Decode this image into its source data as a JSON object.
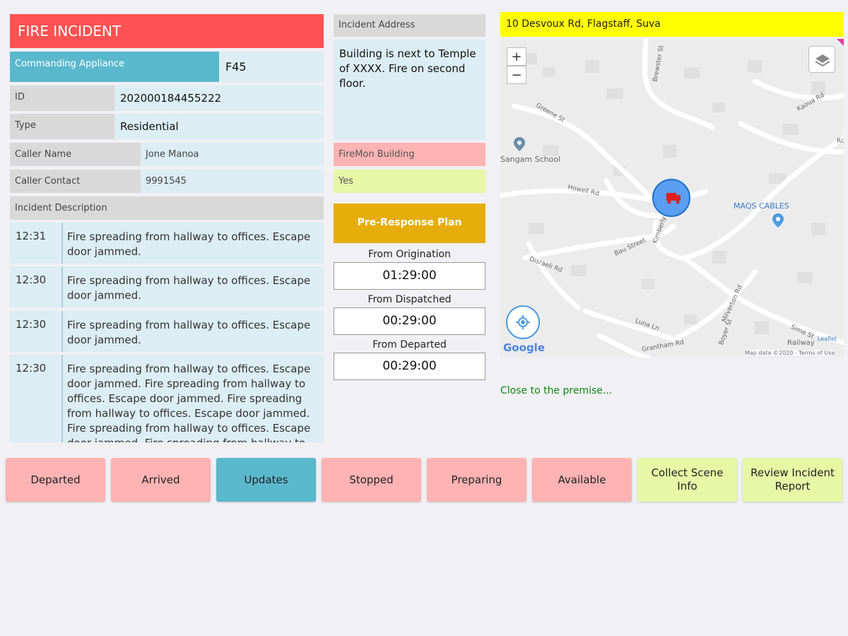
{
  "title": "FIRE INCIDENT",
  "commanding": {
    "label": "Commanding Appliance",
    "value": "F45"
  },
  "fields": {
    "id_label": "ID",
    "id_value": "202000184455222",
    "type_label": "Type",
    "type_value": "Residential",
    "caller_name_label": "Caller Name",
    "caller_name_value": "Jone Manoa",
    "caller_contact_label": "Caller Contact",
    "caller_contact_value": "9991545"
  },
  "description_header": "Incident Description",
  "descriptions": [
    {
      "time": "12:31",
      "text": "Fire spreading from hallway to offices. Escape door jammed."
    },
    {
      "time": "12:30",
      "text": "Fire spreading from hallway to offices. Escape door jammed."
    },
    {
      "time": "12:30",
      "text": "Fire spreading from hallway to offices. Escape door jammed."
    },
    {
      "time": "12:30",
      "text": "Fire spreading from hallway to offices. Escape door jammed. Fire spreading from hallway to offices. Escape door jammed. Fire spreading from hallway to offices. Escape door jammed. Fire spreading from hallway to offices. Escape door jammed. Fire spreading from hallway to offices."
    }
  ],
  "address": {
    "label": "Incident Address",
    "text": "Building is next to Temple of XXXX. Fire on second floor.",
    "firemon_label": "FireMon Building",
    "firemon_value": "Yes"
  },
  "pre_response": "Pre-Response Plan",
  "timers": [
    {
      "label": "From Origination",
      "value": "01:29:00"
    },
    {
      "label": "From Dispatched",
      "value": "00:29:00"
    },
    {
      "label": "From Departed",
      "value": "00:29:00"
    }
  ],
  "map": {
    "address_bar": "10 Desvoux Rd, Flagstaff, Suva",
    "zoom_in": "+",
    "zoom_out": "−",
    "poi_school": "Sangam School",
    "poi_cables": "MAQS CABLES",
    "poi_rail": "Railway",
    "streets": [
      "Greene St",
      "Howell Rd",
      "Kimberly St",
      "Bau Street",
      "Disraeli Rd",
      "Milverton Rd",
      "Luna Ln",
      "Grantham Rd",
      "Kaoua Rd",
      "Brewster St",
      "Sime St",
      "Boyer St",
      "Rd"
    ],
    "google": "Google",
    "leaflet": "Leaflet",
    "attribution": "Map data ©2020 · Terms of Use",
    "marker_icon": "fire-truck-icon",
    "layers_icon": "layers-icon",
    "locate_icon": "locate-icon"
  },
  "status_note": "Close to the premise...",
  "buttons": [
    {
      "label": "Departed",
      "color": "#ffb3b3"
    },
    {
      "label": "Arrived",
      "color": "#ffb3b3"
    },
    {
      "label": "Updates",
      "color": "#5ab8cc"
    },
    {
      "label": "Stopped",
      "color": "#ffb3b3"
    },
    {
      "label": "Preparing",
      "color": "#ffb3b3"
    },
    {
      "label": "Available",
      "color": "#ffb3b3"
    },
    {
      "label": "Collect Scene Info",
      "color": "#e7f7a6"
    },
    {
      "label": "Review Incident Report",
      "color": "#e7f7a6"
    }
  ],
  "colors": {
    "title_bg": "#ff5252",
    "commanding_bg": "#5ab8cc",
    "address_bar_bg": "#ffff00",
    "pre_response_bg": "#e6ad0a",
    "firemon_label_bg": "#ffb3b3",
    "firemon_value_bg": "#e7f7a6",
    "note_text": "#118811"
  }
}
